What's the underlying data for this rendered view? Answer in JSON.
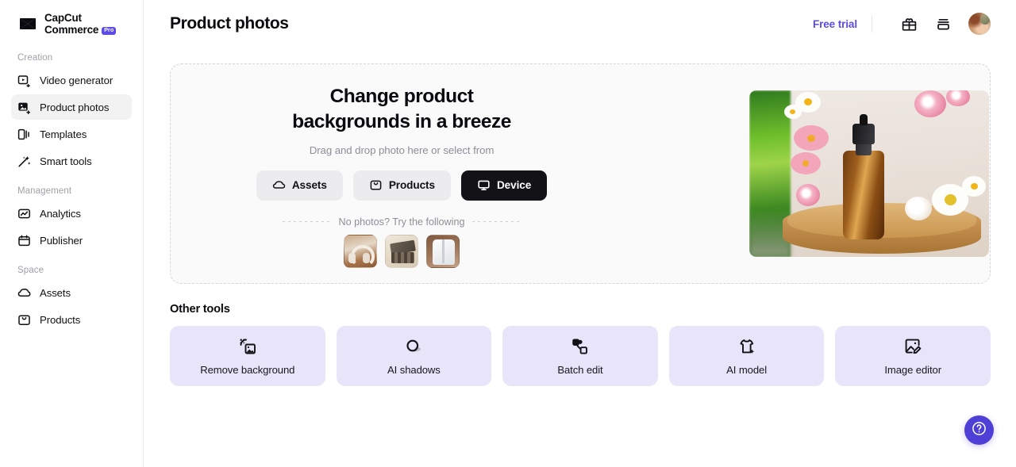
{
  "brand": {
    "line1": "CapCut",
    "line2": "Commerce",
    "badge": "Pro",
    "badge_color": "#5b4ce5",
    "logo_icon": "capcut-logo-icon"
  },
  "sidebar": {
    "groups": [
      {
        "label": "Creation",
        "items": [
          {
            "label": "Video generator",
            "icon": "video-generator-icon",
            "active": false
          },
          {
            "label": "Product photos",
            "icon": "product-photos-icon",
            "active": true
          },
          {
            "label": "Templates",
            "icon": "templates-icon",
            "active": false
          },
          {
            "label": "Smart tools",
            "icon": "smart-tools-wand-icon",
            "active": false
          }
        ]
      },
      {
        "label": "Management",
        "items": [
          {
            "label": "Analytics",
            "icon": "analytics-icon",
            "active": false
          },
          {
            "label": "Publisher",
            "icon": "publisher-calendar-icon",
            "active": false
          }
        ]
      },
      {
        "label": "Space",
        "items": [
          {
            "label": "Assets",
            "icon": "cloud-assets-icon",
            "active": false
          },
          {
            "label": "Products",
            "icon": "products-bag-icon",
            "active": false
          }
        ]
      }
    ]
  },
  "header": {
    "title": "Product photos",
    "free_trial": "Free trial",
    "free_trial_color": "#5b4ce5",
    "icons": [
      {
        "name": "gift-icon"
      },
      {
        "name": "layers-stack-icon"
      }
    ],
    "avatar": "user-avatar"
  },
  "hero": {
    "heading": "Change product backgrounds in a breeze",
    "subheading": "Drag and drop photo here or select from",
    "buttons": [
      {
        "label": "Assets",
        "icon": "cloud-icon",
        "primary": false
      },
      {
        "label": "Products",
        "icon": "bag-icon",
        "primary": false
      },
      {
        "label": "Device",
        "icon": "monitor-icon",
        "primary": true
      }
    ],
    "divider_text": "No photos? Try the following",
    "samples": [
      {
        "name": "sample-headphones",
        "alt": "White headphones on wooden table"
      },
      {
        "name": "sample-eyeshadow-palette",
        "alt": "Eyeshadow palette on cream background"
      },
      {
        "name": "sample-white-shirt",
        "alt": "White dress shirt on brown background"
      }
    ],
    "preview_image": "amber-dropper-bottle-with-flowers-on-wooden-tray"
  },
  "other_tools": {
    "title": "Other tools",
    "cards": [
      {
        "label": "Remove background",
        "icon": "remove-background-icon"
      },
      {
        "label": "AI shadows",
        "icon": "ai-shadows-icon"
      },
      {
        "label": "Batch edit",
        "icon": "batch-edit-icon"
      },
      {
        "label": "AI model",
        "icon": "ai-model-shirt-icon"
      },
      {
        "label": "Image editor",
        "icon": "image-editor-icon"
      }
    ],
    "card_color": "#e8e4f9"
  },
  "help": {
    "icon": "help-question-icon",
    "color": "#4e3fd6"
  }
}
